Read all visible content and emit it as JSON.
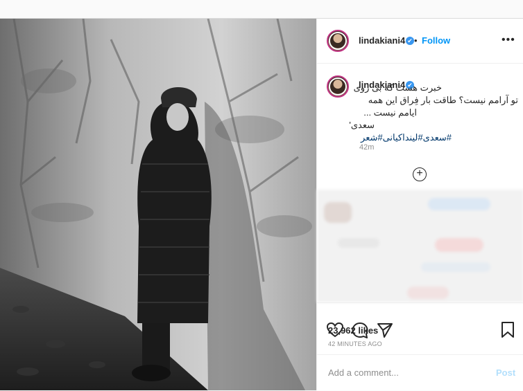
{
  "post": {
    "username": "lindakiani4",
    "verified_badge": "✔",
    "separator": "•",
    "follow_label": "Follow",
    "more_icon": "more-dots-icon",
    "caption": {
      "line1": "خبرت هست که بی روی",
      "line2": "تو آرامم نیست؟ طاقت بار فِراق این همه",
      "line3": "ایامم نیست ...",
      "line4": "سعدی'",
      "hashtags": "#سعدی#لینداکیانی#شعر"
    },
    "caption_time": "42m",
    "load_more_icon": "plus-circle-icon",
    "likes": "23,962 likes",
    "time_ago": "42 MINUTES AGO",
    "comment_placeholder": "Add a comment...",
    "post_button": "Post",
    "icons": [
      "heart-icon",
      "comment-icon",
      "share-icon",
      "bookmark-icon"
    ],
    "colors": {
      "link": "#0095f6",
      "hashtag": "#00376b",
      "avatar_ring": "#c13584",
      "muted": "#8e8e8e",
      "post_disabled": "#b2dffc"
    }
  }
}
